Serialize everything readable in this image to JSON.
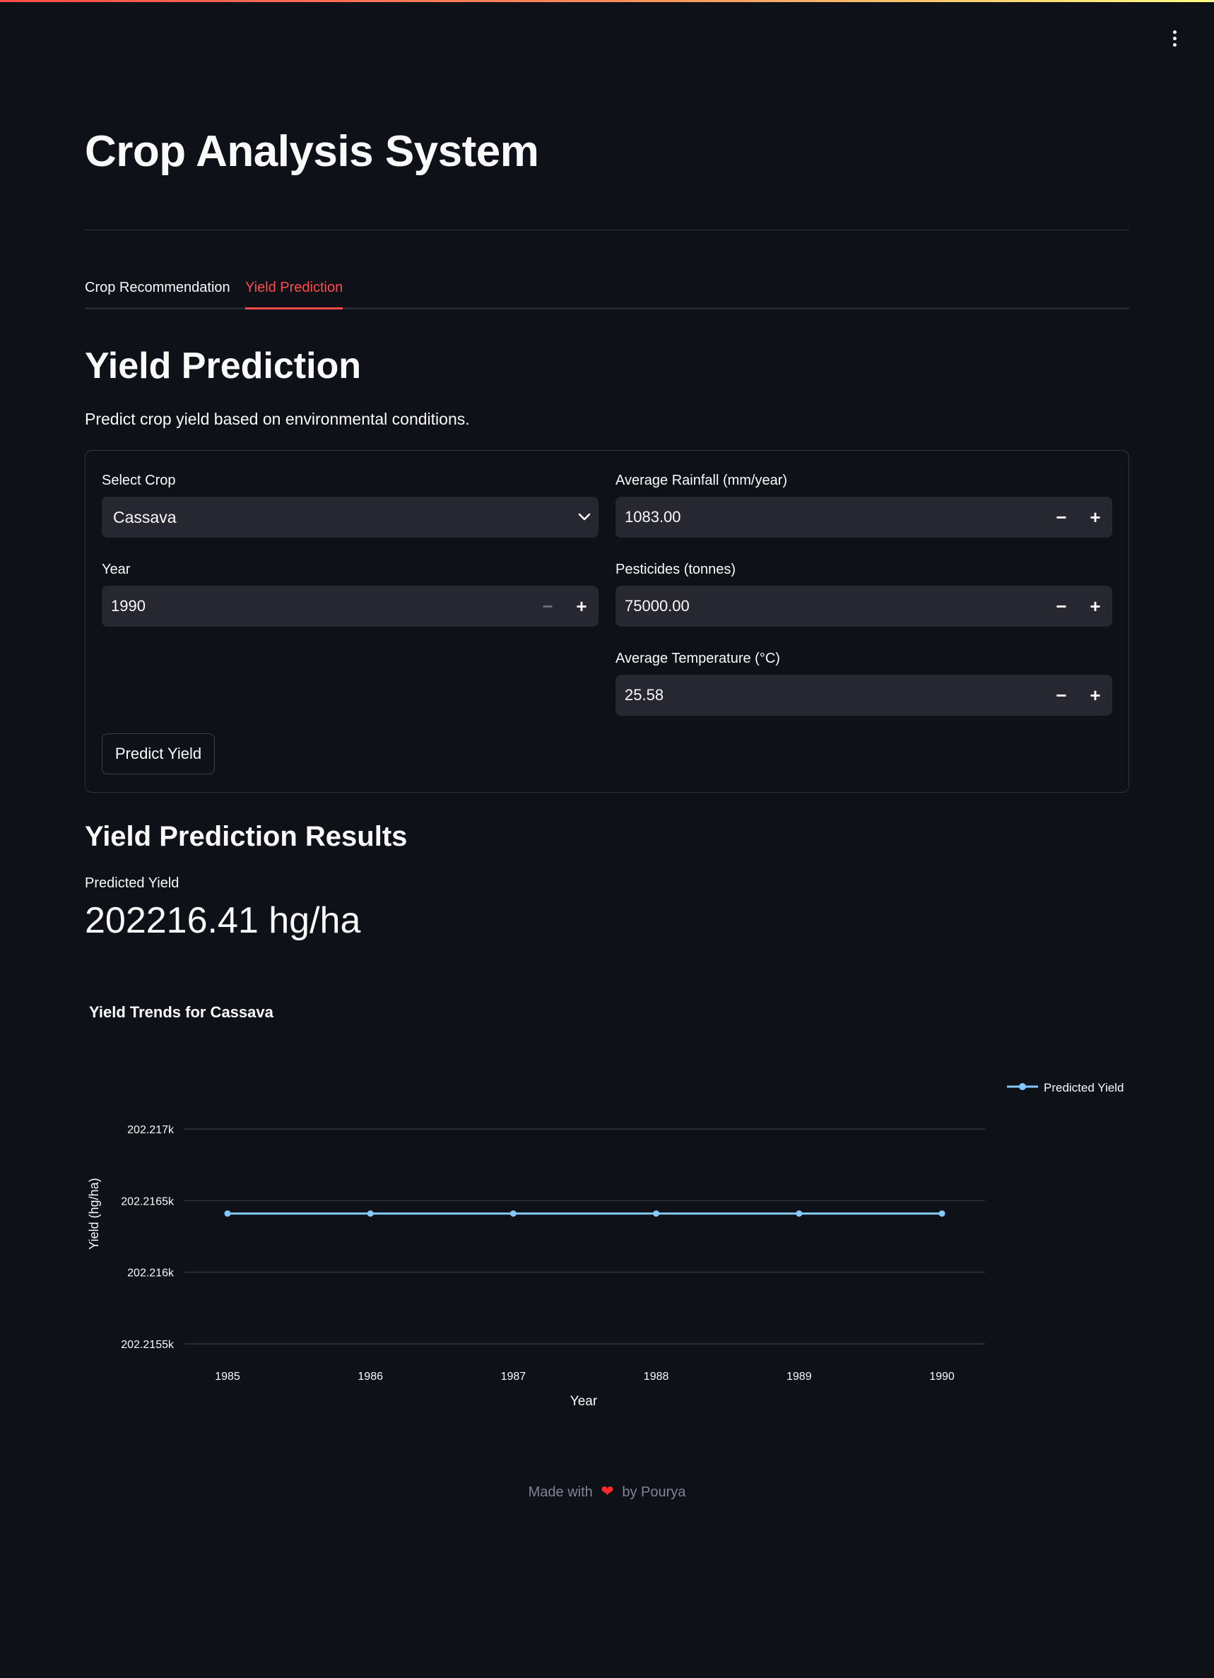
{
  "app": {
    "title": "Crop Analysis System"
  },
  "tabs": [
    {
      "label": "Crop Recommendation",
      "active": false
    },
    {
      "label": "Yield Prediction",
      "active": true
    }
  ],
  "section": {
    "title": "Yield Prediction",
    "description": "Predict crop yield based on environmental conditions."
  },
  "form": {
    "crop": {
      "label": "Select Crop",
      "value": "Cassava"
    },
    "year": {
      "label": "Year",
      "value": "1990"
    },
    "rainfall": {
      "label": "Average Rainfall (mm/year)",
      "value": "1083.00"
    },
    "pesticides": {
      "label": "Pesticides (tonnes)",
      "value": "75000.00"
    },
    "temperature": {
      "label": "Average Temperature (°C)",
      "value": "25.58"
    },
    "submit_label": "Predict Yield"
  },
  "results": {
    "title": "Yield Prediction Results",
    "metric_label": "Predicted Yield",
    "metric_value": "202216.41 hg/ha"
  },
  "chart_data": {
    "type": "line",
    "title": "Yield Trends for Cassava",
    "xlabel": "Year",
    "ylabel": "Yield (hg/ha)",
    "x": [
      1985,
      1986,
      1987,
      1988,
      1989,
      1990
    ],
    "series": [
      {
        "name": "Predicted Yield",
        "color": "#83c9ff",
        "values": [
          202216.41,
          202216.41,
          202216.41,
          202216.41,
          202216.41,
          202216.41
        ]
      }
    ],
    "yticks": [
      202215.5,
      202216,
      202216.5,
      202217
    ],
    "ytick_labels": [
      "202.2155k",
      "202.216k",
      "202.2165k",
      "202.217k"
    ],
    "ylim": [
      202215.5,
      202217
    ],
    "grid": true,
    "legend_position": "top-right"
  },
  "footer": {
    "prefix": "Made with",
    "heart": "❤",
    "suffix": "by Pourya"
  },
  "colors": {
    "background": "#0e1117",
    "accent": "#ff4b4b",
    "input_bg": "#262730",
    "series": "#83c9ff"
  }
}
